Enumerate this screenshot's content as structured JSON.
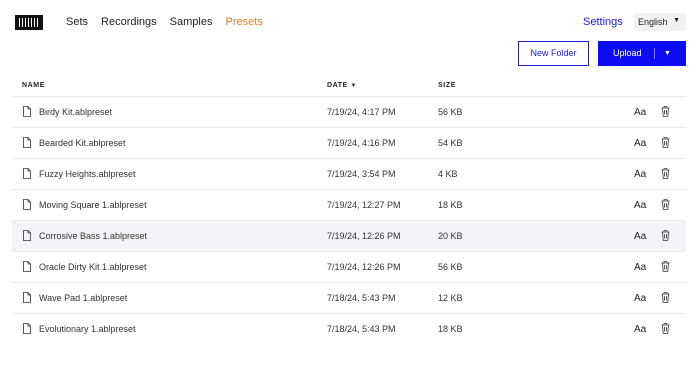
{
  "nav": {
    "items": [
      {
        "label": "Sets",
        "active": false
      },
      {
        "label": "Recordings",
        "active": false
      },
      {
        "label": "Samples",
        "active": false
      },
      {
        "label": "Presets",
        "active": true
      }
    ],
    "settings_label": "Settings",
    "language": "English"
  },
  "actions": {
    "new_folder_label": "New Folder",
    "upload_label": "Upload"
  },
  "table": {
    "headers": {
      "name": "NAME",
      "date": "DATE",
      "date_sort": "▼",
      "size": "SIZE"
    },
    "rows": [
      {
        "name": "Birdy Kit.ablpreset",
        "date": "7/19/24, 4:17 PM",
        "size": "56 KB",
        "action": "Aa"
      },
      {
        "name": "Bearded Kit.ablpreset",
        "date": "7/19/24, 4:16 PM",
        "size": "54 KB",
        "action": "Aa"
      },
      {
        "name": "Fuzzy Heights.ablpreset",
        "date": "7/19/24, 3:54 PM",
        "size": "4 KB",
        "action": "Aa"
      },
      {
        "name": "Moving Square 1.ablpreset",
        "date": "7/19/24, 12:27 PM",
        "size": "18 KB",
        "action": "Aa"
      },
      {
        "name": "Corrosive Bass 1.ablpreset",
        "date": "7/19/24, 12:26 PM",
        "size": "20 KB",
        "action": "Aa"
      },
      {
        "name": "Oracle Dirty Kit 1.ablpreset",
        "date": "7/19/24, 12:26 PM",
        "size": "56 KB",
        "action": "Aa"
      },
      {
        "name": "Wave Pad 1.ablpreset",
        "date": "7/18/24, 5:43 PM",
        "size": "12 KB",
        "action": "Aa"
      },
      {
        "name": "Evolutionary 1.ablpreset",
        "date": "7/18/24, 5:43 PM",
        "size": "18 KB",
        "action": "Aa"
      }
    ],
    "highlighted_row": 4
  },
  "colors": {
    "accent_blue": "#0c0cf0",
    "active_nav": "#e0812f",
    "row_highlight": "#f4f4f8"
  }
}
